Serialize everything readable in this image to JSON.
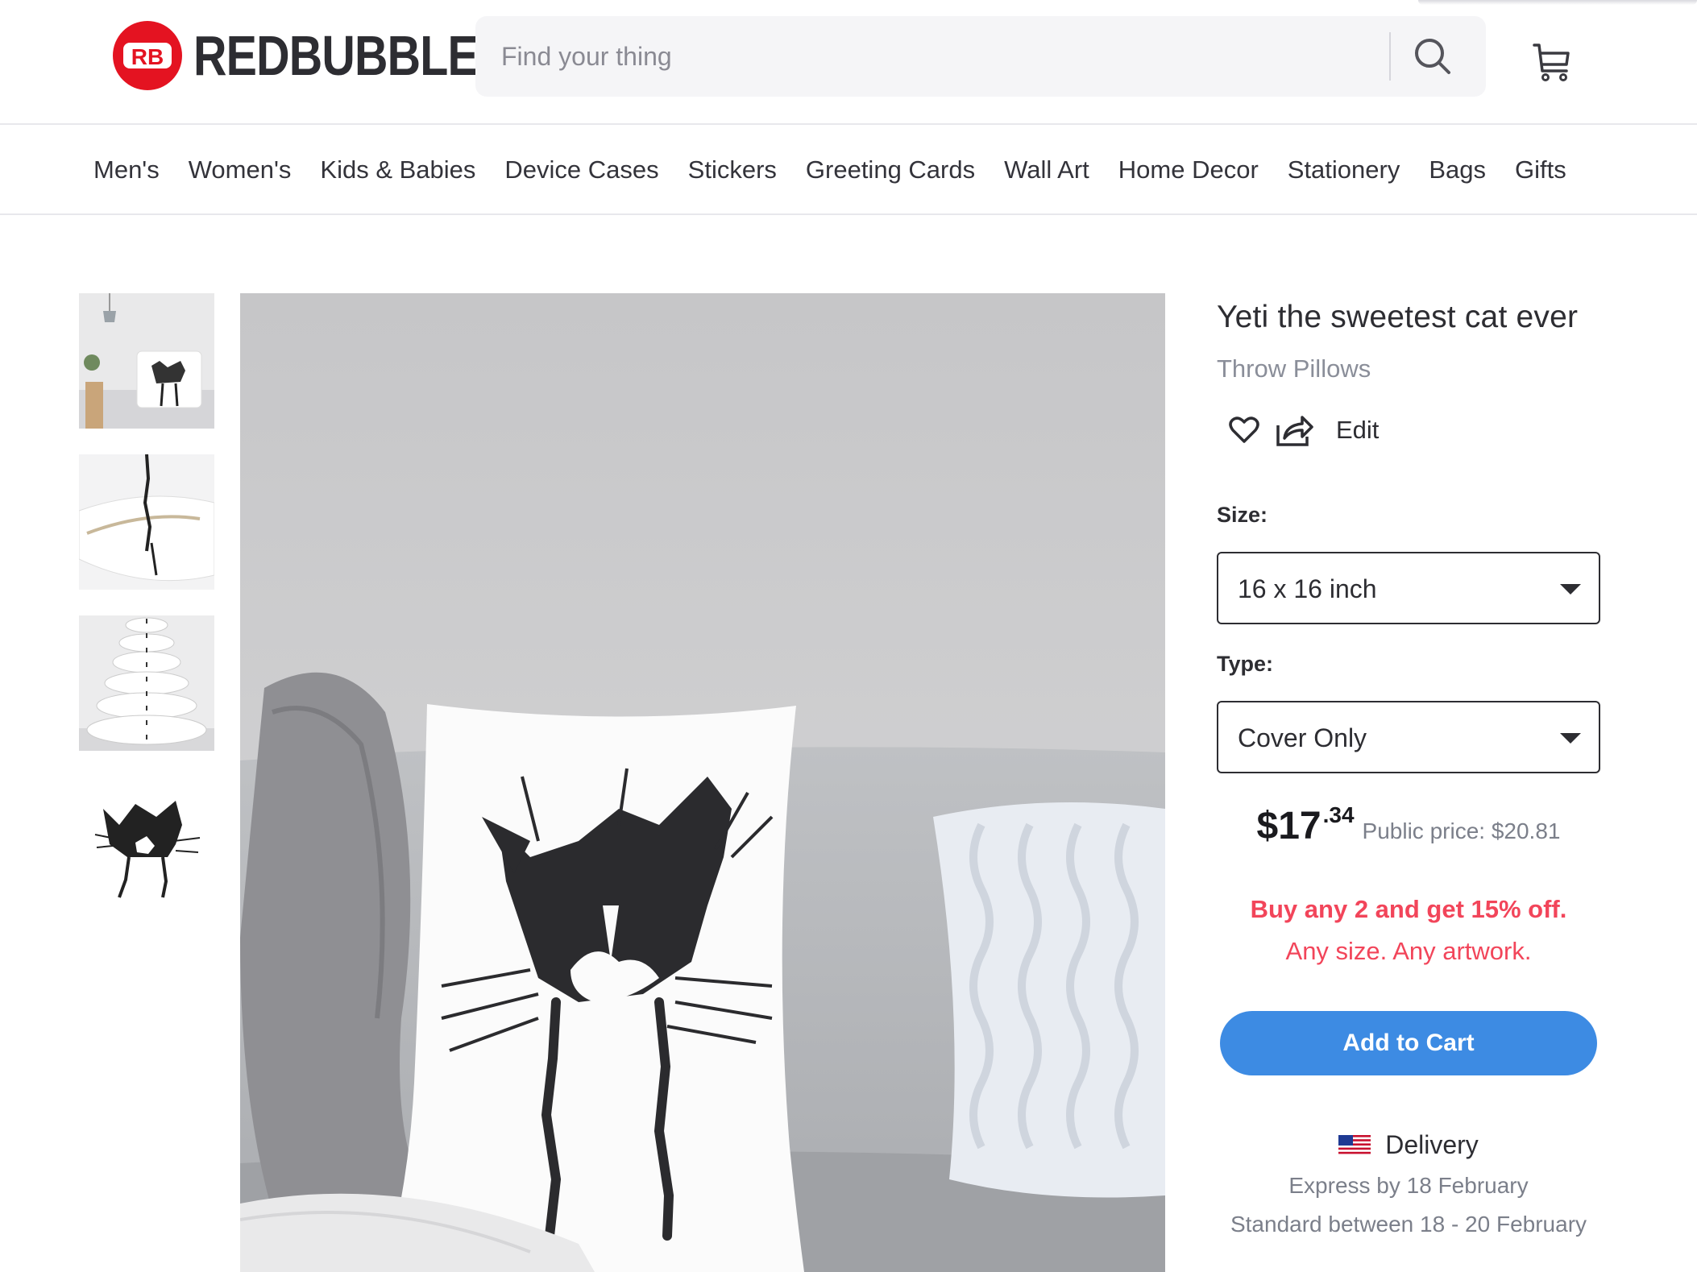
{
  "header": {
    "logo_text": "REDBUBBLE",
    "logo_badge_text": "RB",
    "search_placeholder": "Find your thing",
    "brand_color": "#e41321"
  },
  "nav": {
    "items": [
      "Men's",
      "Women's",
      "Kids & Babies",
      "Device Cases",
      "Stickers",
      "Greeting Cards",
      "Wall Art",
      "Home Decor",
      "Stationery",
      "Bags",
      "Gifts"
    ]
  },
  "gallery": {
    "thumbnails": [
      "pillow-on-bed-scene",
      "pillow-zipper-closeup",
      "pillow-stack",
      "cat-artwork"
    ],
    "main_image": "pillow-on-sofa"
  },
  "product": {
    "title": "Yeti the sweetest cat ever",
    "category": "Throw Pillows",
    "edit_label": "Edit",
    "size_label": "Size:",
    "size_value": "16 x 16 inch",
    "type_label": "Type:",
    "type_value": "Cover Only",
    "price_dollars": "$17",
    "price_cents": ".34",
    "public_price": "Public price: $20.81",
    "promo_headline": "Buy any 2 and get 15% off.",
    "promo_detail": "Any size. Any artwork.",
    "add_to_cart": "Add to Cart",
    "accent_color": "#3d8be3",
    "promo_color": "#f2455a"
  },
  "delivery": {
    "title": "Delivery",
    "express": "Express by 18 February",
    "standard": "Standard between 18 - 20 February"
  },
  "icons": [
    "search-icon",
    "cart-icon",
    "heart-icon",
    "share-icon",
    "chevron-down-icon",
    "us-flag-icon"
  ]
}
